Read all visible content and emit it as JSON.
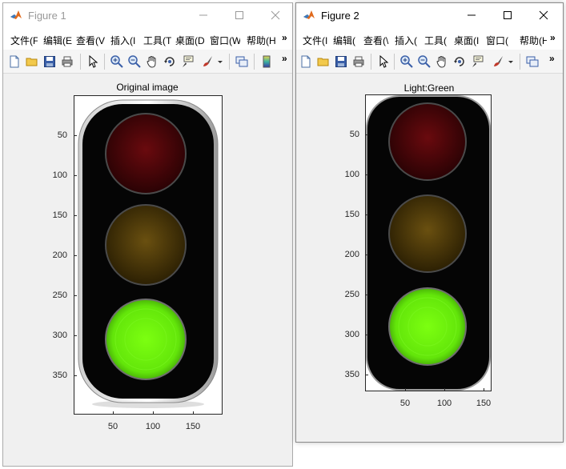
{
  "windows": [
    {
      "id": "win1",
      "title": "Figure 1",
      "active": false,
      "menu": [
        "文件(F",
        "编辑(E",
        "查看(V",
        "插入(I",
        "工具(T",
        "桌面(D",
        "窗口(W",
        "帮助(H"
      ],
      "menu_overflow": "»",
      "toolbar_overflow": "»",
      "plot_title": "Original image",
      "y_ticks": [
        "50",
        "100",
        "150",
        "200",
        "250",
        "300",
        "350"
      ],
      "x_ticks": [
        "50",
        "100",
        "150"
      ],
      "light_state": {
        "red_on": false,
        "yellow_on": false,
        "green_on": true
      }
    },
    {
      "id": "win2",
      "title": "Figure 2",
      "active": true,
      "menu": [
        "文件(I",
        "编辑(",
        "查看(\\",
        "插入(",
        "工具(",
        "桌面(I",
        "窗口(",
        "帮助(H"
      ],
      "menu_overflow": "»",
      "toolbar_overflow": "»",
      "plot_title": "Light:Green",
      "y_ticks": [
        "50",
        "100",
        "150",
        "200",
        "250",
        "300",
        "350"
      ],
      "x_ticks": [
        "50",
        "100",
        "150"
      ],
      "light_state": {
        "red_on": false,
        "yellow_on": false,
        "green_on": true
      }
    }
  ],
  "toolbar_icons": [
    "new-file-icon",
    "open-folder-icon",
    "save-icon",
    "print-icon",
    "pointer-icon",
    "zoom-in-icon",
    "zoom-out-icon",
    "pan-hand-icon",
    "rotate-3d-icon",
    "data-cursor-icon",
    "brush-icon",
    "brush-dropdown-icon",
    "link-plot-icon",
    "colorbar-icon"
  ],
  "colors": {
    "red_lens": "#4a0306",
    "yellow_lens": "#4d3a04",
    "green_lens": "#6ef20a",
    "housing": "#050505",
    "titlebar_inactive_text": "#999999",
    "titlebar_active_text": "#000000"
  }
}
